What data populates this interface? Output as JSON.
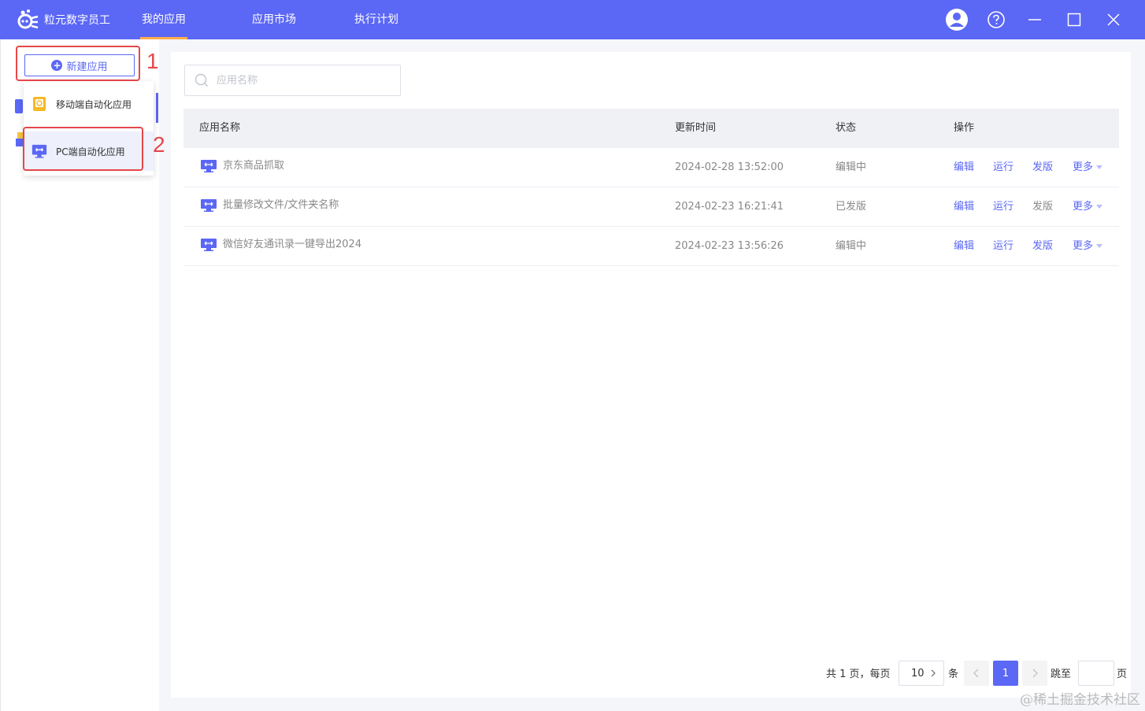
{
  "titlebar": {
    "app_name": "粒元数字员工",
    "tabs": [
      {
        "label": "我的应用",
        "active": true
      },
      {
        "label": "应用市场",
        "active": false
      },
      {
        "label": "执行计划",
        "active": false
      }
    ],
    "icons": [
      "user-avatar-icon",
      "help-icon",
      "minimize-icon",
      "maximize-icon",
      "close-icon"
    ]
  },
  "sidebar": {
    "new_button_label": "新建应用",
    "dropdown": {
      "items": [
        {
          "label": "移动端自动化应用",
          "icon": "mobile-app-icon"
        },
        {
          "label": "PC端自动化应用",
          "icon": "pc-app-icon"
        }
      ]
    },
    "annotations": {
      "step1": "1",
      "step2": "2"
    }
  },
  "search": {
    "placeholder": "应用名称"
  },
  "table": {
    "headers": [
      "应用名称",
      "更新时间",
      "状态",
      "操作"
    ],
    "rows": [
      {
        "name": "京东商品抓取",
        "updated": "2024-02-28 13:52:00",
        "status": "编辑中"
      },
      {
        "name": "批量修改文件/文件夹名称",
        "updated": "2024-02-23 16:21:41",
        "status": "已发版"
      },
      {
        "name": "微信好友通讯录一键导出2024",
        "updated": "2024-02-23 13:56:26",
        "status": "编辑中"
      }
    ],
    "actions": {
      "edit": "编辑",
      "run": "运行",
      "publish": "发版",
      "more": "更多"
    }
  },
  "pagination": {
    "summary": "共 1 页，每页",
    "page_size": "10",
    "unit": "条",
    "current_page": "1",
    "jump_label": "跳至",
    "page_suffix": "页"
  },
  "watermark": "@稀土掘金技术社区",
  "colors": {
    "accent": "#5b67f5",
    "annotation": "#e5474b",
    "tab_underline": "#ffad4d"
  }
}
